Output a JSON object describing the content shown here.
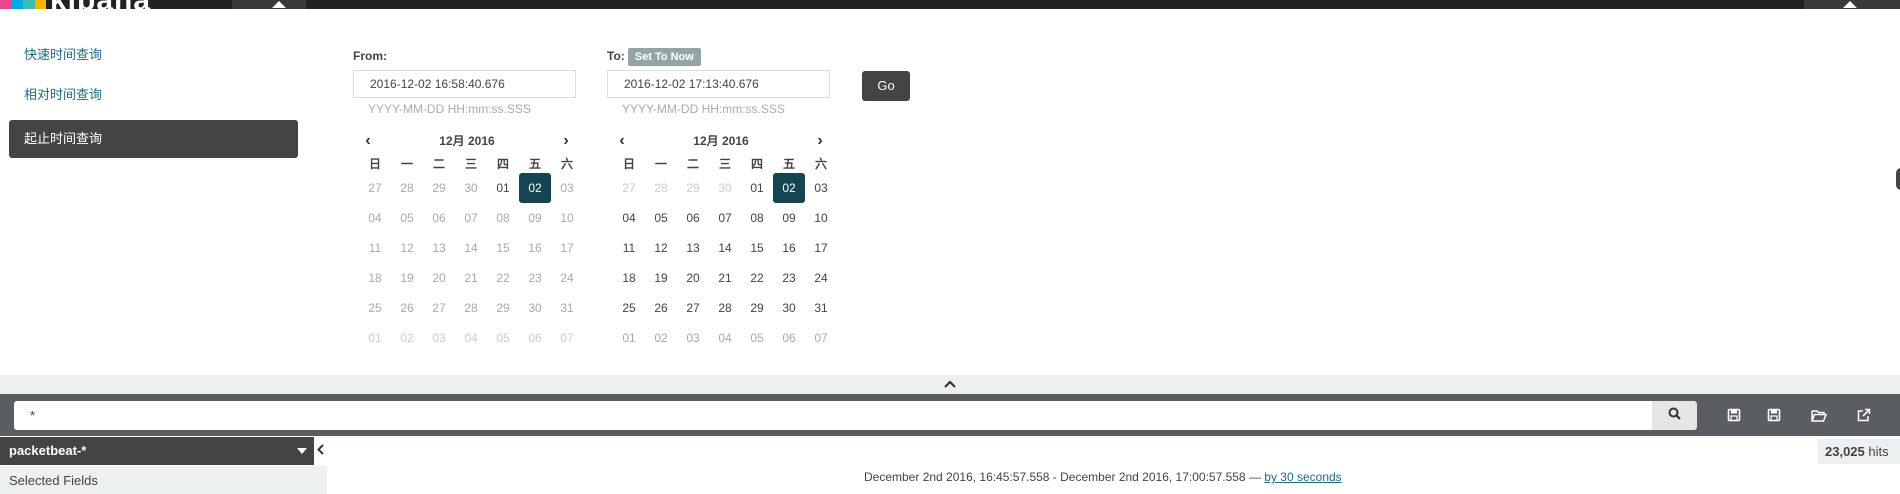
{
  "brand": {
    "name": "kibana",
    "stripe_colors": [
      "#e8488b",
      "#00a9e5",
      "#3ebeb0",
      "#f5b700"
    ]
  },
  "time_modes": [
    {
      "label": "快速时间查询",
      "active": false
    },
    {
      "label": "相对时间查询",
      "active": false
    },
    {
      "label": "起止时间查询",
      "active": true
    }
  ],
  "from": {
    "label": "From:",
    "value": "2016-12-02 16:58:40.676",
    "hint": "YYYY-MM-DD HH:mm:ss.SSS",
    "calendar": {
      "month_label": "12月 2016",
      "weekdays": [
        "日",
        "一",
        "二",
        "三",
        "四",
        "五",
        "六"
      ],
      "weeks": [
        [
          "27",
          "28",
          "29",
          "30",
          "01",
          "02",
          "03"
        ],
        [
          "04",
          "05",
          "06",
          "07",
          "08",
          "09",
          "10"
        ],
        [
          "11",
          "12",
          "13",
          "14",
          "15",
          "16",
          "17"
        ],
        [
          "18",
          "19",
          "20",
          "21",
          "22",
          "23",
          "24"
        ],
        [
          "25",
          "26",
          "27",
          "28",
          "29",
          "30",
          "31"
        ],
        [
          "01",
          "02",
          "03",
          "04",
          "05",
          "06",
          "07"
        ]
      ],
      "selected": "02"
    }
  },
  "to": {
    "label": "To:",
    "set_now_label": "Set To Now",
    "value": "2016-12-02 17:13:40.676",
    "hint": "YYYY-MM-DD HH:mm:ss.SSS",
    "calendar": {
      "month_label": "12月 2016",
      "weekdays": [
        "日",
        "一",
        "二",
        "三",
        "四",
        "五",
        "六"
      ],
      "weeks": [
        [
          "27",
          "28",
          "29",
          "30",
          "01",
          "02",
          "03"
        ],
        [
          "04",
          "05",
          "06",
          "07",
          "08",
          "09",
          "10"
        ],
        [
          "11",
          "12",
          "13",
          "14",
          "15",
          "16",
          "17"
        ],
        [
          "18",
          "19",
          "20",
          "21",
          "22",
          "23",
          "24"
        ],
        [
          "25",
          "26",
          "27",
          "28",
          "29",
          "30",
          "31"
        ],
        [
          "01",
          "02",
          "03",
          "04",
          "05",
          "06",
          "07"
        ]
      ],
      "selected": "02"
    }
  },
  "go_label": "Go",
  "search": {
    "query": "*",
    "icon": "search-icon"
  },
  "toolbar_icons": [
    "new-search-icon",
    "save-search-icon",
    "open-search-icon",
    "share-icon"
  ],
  "index": {
    "name": "packetbeat-*"
  },
  "fields_panel": {
    "title": "Selected Fields"
  },
  "hits": {
    "count": "23,025",
    "label": "hits"
  },
  "time_range": {
    "text": "December 2nd 2016, 16:45:57.558 - December 2nd 2016, 17:00:57.558 —",
    "interval_link": "by 30 seconds"
  },
  "colors": {
    "accent": "#1f6b7a",
    "selected_day": "#144551",
    "dark_button": "#444444"
  }
}
